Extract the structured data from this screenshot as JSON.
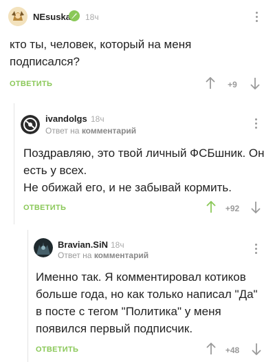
{
  "colors": {
    "accent": "#8ac858",
    "muted": "#9a9a9a",
    "verified": "#8ac858"
  },
  "comments": [
    {
      "author": "NEsuska",
      "verified": true,
      "time": "18ч",
      "text": "кто ты, человек, который на меня подписался?",
      "reply_label": "ОТВЕТИТЬ",
      "rating": "+9",
      "avatar_icon": "user-avatar-icon"
    },
    {
      "author": "ivandolgs",
      "time": "18ч",
      "reply_to_prefix": "Ответ на",
      "reply_to_target": "комментарий",
      "text_line1": "Поздравляю, это твой личный ФСБшник. Он есть у всех.",
      "text_line2": "Не обижай его, и не забывай кормить.",
      "reply_label": "ОТВЕТИТЬ",
      "rating": "+92",
      "upvoted": true,
      "avatar_icon": "user-avatar-icon"
    },
    {
      "author": "Bravian.SiN",
      "time": "18ч",
      "reply_to_prefix": "Ответ на",
      "reply_to_target": "комментарий",
      "text": "Именно так. Я комментировал котиков больше года, но как только написал \"Да\" в посте с тегом \"Политика\" у меня появился первый подписчик.",
      "reply_label": "ОТВЕТИТЬ",
      "rating": "+48",
      "avatar_icon": "user-avatar-icon"
    }
  ]
}
